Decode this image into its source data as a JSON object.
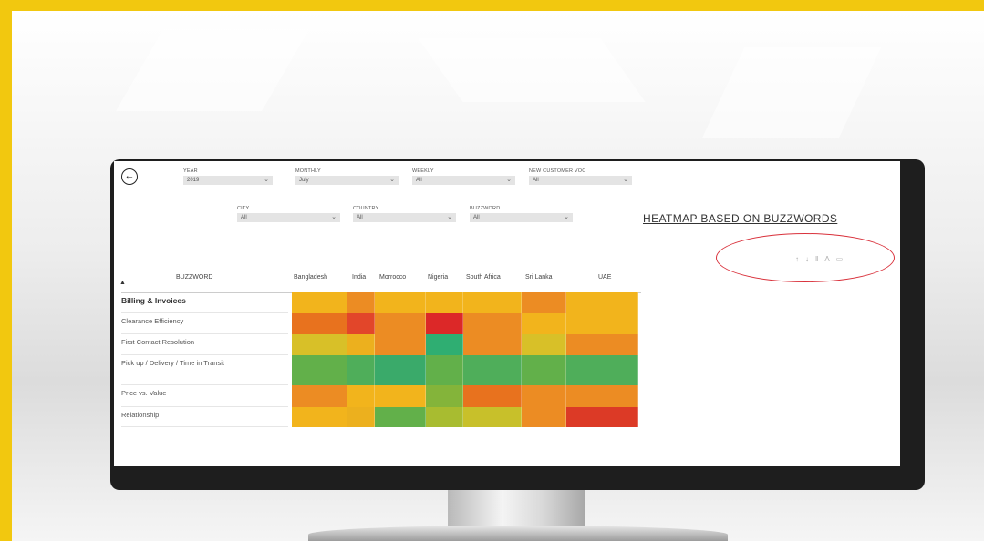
{
  "filters": {
    "row1": [
      {
        "label": "YEAR",
        "value": "2019"
      },
      {
        "label": "MONTHLY",
        "value": "July"
      },
      {
        "label": "WEEKLY",
        "value": "All"
      },
      {
        "label": "NEW CUSTOMER VOC",
        "value": "All"
      }
    ],
    "row2": [
      {
        "label": "CITY",
        "value": "All"
      },
      {
        "label": "COUNTRY",
        "value": "All"
      },
      {
        "label": "BUZZWORD",
        "value": "All"
      }
    ]
  },
  "title": "HEATMAP BASED ON BUZZWORDS",
  "toolbar_icons": [
    "sort-up-icon",
    "sort-down-icon",
    "expand-icon",
    "drill-icon",
    "focus-icon"
  ],
  "heatmap": {
    "row_header": "BUZZWORD",
    "columns": [
      "Bangladesh",
      "India",
      "Morrocco",
      "Nigeria",
      "South Africa",
      "Sri Lanka",
      "UAE"
    ],
    "rows": [
      "Billing & Invoices",
      "Clearance Efficiency",
      "First Contact Resolution",
      "Pick up / Delivery / Time in Transit",
      "Price vs. Value",
      "Relationship"
    ],
    "colors": [
      [
        "#f2b41c",
        "#ec8c23",
        "#f2b41c",
        "#f2b41c",
        "#f2b41c",
        "#ec8c23",
        "#f2b41c"
      ],
      [
        "#e8721e",
        "#e2462a",
        "#ec8c23",
        "#dc2828",
        "#ec8c23",
        "#f2b41c",
        "#f2b41c"
      ],
      [
        "#d8c028",
        "#ecb01e",
        "#ec8c23",
        "#2fae72",
        "#ec8c23",
        "#d8c028",
        "#ec8c23"
      ],
      [
        "#62b04a",
        "#4fae5a",
        "#3aaa6a",
        "#62b04a",
        "#4fae5a",
        "#62b04a",
        "#4fae5a"
      ],
      [
        "#ec8c23",
        "#f2b41c",
        "#f2b41c",
        "#84b43a",
        "#e8721e",
        "#ec8c23",
        "#ec8c23"
      ],
      [
        "#f2b41c",
        "#ecb01e",
        "#62b04a",
        "#a8bc30",
        "#c8c02a",
        "#ec8c23",
        "#dc3a26"
      ]
    ]
  }
}
